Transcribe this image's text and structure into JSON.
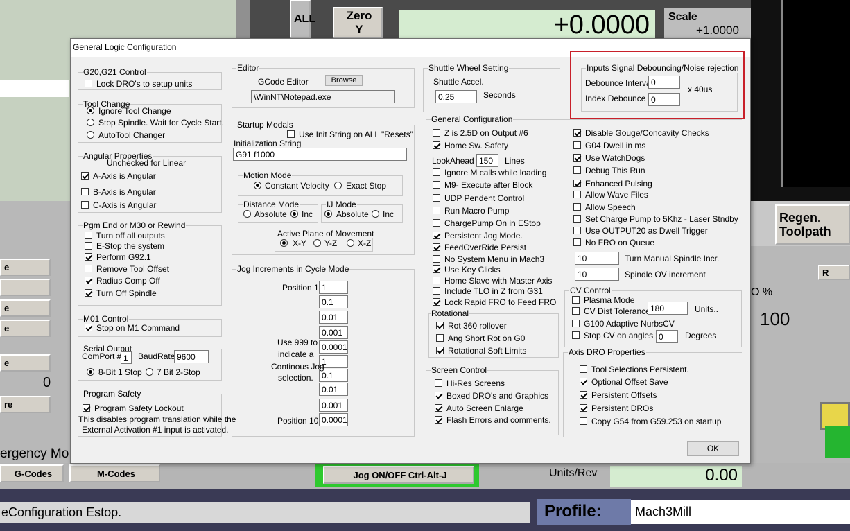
{
  "background": {
    "all_label": "ALL",
    "zero_label": "Zero",
    "zero_axis": "Y",
    "dro_value": "+0.0000",
    "scale_label": "Scale",
    "scale_value": "+1.0000",
    "regen_label": "Regen.\nToolpath",
    "pct_label": "O %",
    "pct_value": "100",
    "units_rev_label": "Units/Rev",
    "units_rev_value": "0.00",
    "left_zero": "0",
    "emergency_text": "ergency Mo",
    "gcodes_btn": "G-Codes",
    "mcodes_btn": "M-Codes",
    "jog_btn": "Jog ON/OFF Ctrl-Alt-J",
    "status_text": "eConfiguration Estop.",
    "profile_label": "Profile:",
    "profile_value": "Mach3Mill",
    "left_btns": [
      "e",
      "",
      "e",
      "e",
      "e",
      "re"
    ],
    "right_btn": "R"
  },
  "dialog": {
    "title": "General Logic Configuration",
    "g20": {
      "label": "G20,G21 Control",
      "lock_dro": "Lock DRO's to setup units",
      "lock_dro_checked": false
    },
    "tool_change": {
      "label": "Tool Change",
      "options": [
        "Ignore Tool Change",
        "Stop Spindle. Wait for Cycle Start.",
        "AutoTool Changer"
      ],
      "selected": 0
    },
    "angular": {
      "label": "Angular Properties",
      "note": "Unchecked for Linear",
      "a": "A-Axis is Angular",
      "a_checked": true,
      "b": "B-Axis is Angular",
      "b_checked": false,
      "c": "C-Axis is Angular",
      "c_checked": false
    },
    "pgm_end": {
      "label": "Pgm End or M30 or Rewind",
      "items": [
        {
          "text": "Turn off all outputs",
          "checked": false
        },
        {
          "text": "E-Stop the system",
          "checked": false
        },
        {
          "text": "Perform G92.1",
          "checked": true
        },
        {
          "text": "Remove Tool Offset",
          "checked": false
        },
        {
          "text": "Radius Comp Off",
          "checked": true
        },
        {
          "text": "Turn Off Spindle",
          "checked": true
        }
      ]
    },
    "m01": {
      "label": "M01 Control",
      "stop": "Stop on M1 Command",
      "stop_checked": true
    },
    "serial": {
      "label": "Serial Output",
      "comport_label": "ComPort #",
      "comport": "1",
      "baud_label": "BaudRate",
      "baud": "9600",
      "bit8": "8-Bit 1 Stop",
      "bit7": "7 Bit 2-Stop",
      "selected": 0
    },
    "safety": {
      "label": "Program Safety",
      "lockout": "Program Safety Lockout",
      "lockout_checked": true,
      "note1": "This disables program translation while the",
      "note2": "External Activation #1 input is activated."
    },
    "editor": {
      "label": "Editor",
      "gcode_label": "GCode Editor",
      "browse": "Browse",
      "path": "\\WinNT\\Notepad.exe"
    },
    "startup": {
      "label": "Startup Modals",
      "use_init": "Use Init String on ALL  \"Resets\"",
      "use_init_checked": false,
      "init_label": "Initialization String",
      "init_value": "G91 f1000",
      "motion_label": "Motion Mode",
      "constant": "Constant Velocity",
      "exact": "Exact Stop",
      "motion_sel": 0,
      "distance_label": "Distance Mode",
      "absolute": "Absolute",
      "inc": "Inc",
      "distance_sel": 1,
      "ij_label": "IJ Mode",
      "ij_absolute": "Absolute",
      "ij_inc": "Inc",
      "ij_sel": 0,
      "plane_label": "Active Plane of Movement",
      "xy": "X-Y",
      "yz": "Y-Z",
      "xz": "X-Z",
      "plane_sel": 0
    },
    "jog": {
      "label": "Jog Increments in Cycle Mode",
      "pos1": "Position 1",
      "pos10": "Position 10",
      "values": [
        "1",
        "0.1",
        "0.01",
        "0.001",
        "0.0001",
        "1",
        "0.1",
        "0.01",
        "0.001",
        "0.0001"
      ],
      "note": [
        "Use 999 to",
        "indicate a",
        "Continous Jog",
        "selection."
      ]
    },
    "shuttle": {
      "label": "Shuttle Wheel Setting",
      "accel_label": "Shuttle Accel.",
      "accel": "0.25",
      "seconds": "Seconds"
    },
    "debounce": {
      "label": "Inputs Signal Debouncing/Noise rejection",
      "interval_label": "Debounce Interval",
      "interval": "0",
      "index_label": "Index Debounce",
      "index": "0",
      "unit": "x 40us"
    },
    "general": {
      "label": "General Configuration",
      "left": [
        {
          "text": "Z is 2.5D on Output #6",
          "checked": false
        },
        {
          "text": "Home Sw. Safety",
          "checked": true
        }
      ],
      "lookahead_label": "LookAhead",
      "lookahead": "150",
      "lines": "Lines",
      "left2": [
        {
          "text": "Ignore M calls while loading",
          "checked": false
        },
        {
          "text": "M9- Execute after Block",
          "checked": false
        },
        {
          "text": "UDP Pendent Control",
          "checked": false
        },
        {
          "text": "Run Macro Pump",
          "checked": false
        },
        {
          "text": "ChargePump On in EStop",
          "checked": false
        },
        {
          "text": "Persistent Jog Mode.",
          "checked": true
        },
        {
          "text": "FeedOverRide Persist",
          "checked": true
        },
        {
          "text": "No System Menu in Mach3",
          "checked": false
        },
        {
          "text": "Use Key Clicks",
          "checked": true
        },
        {
          "text": "Home Slave with Master Axis",
          "checked": false
        },
        {
          "text": "Include TLO in Z from G31",
          "checked": false
        },
        {
          "text": "Lock Rapid FRO to Feed FRO",
          "checked": true
        }
      ],
      "right": [
        {
          "text": "Disable Gouge/Concavity Checks",
          "checked": true
        },
        {
          "text": "G04 Dwell in ms",
          "checked": false
        },
        {
          "text": "Use WatchDogs",
          "checked": true
        },
        {
          "text": "Debug This Run",
          "checked": false
        },
        {
          "text": "Enhanced Pulsing",
          "checked": true
        },
        {
          "text": "Allow Wave Files",
          "checked": false
        },
        {
          "text": "Allow Speech",
          "checked": false
        },
        {
          "text": "Set Charge Pump to 5Khz  - Laser Stndby",
          "checked": false
        },
        {
          "text": "Use OUTPUT20 as Dwell Trigger",
          "checked": false
        },
        {
          "text": "No FRO on Queue",
          "checked": false
        }
      ],
      "manual_spindle": "10",
      "manual_spindle_label": "Turn Manual Spindle Incr.",
      "spindle_ov": "10",
      "spindle_ov_label": "Spindle OV increment"
    },
    "rotational": {
      "label": "Rotational",
      "items": [
        {
          "text": "Rot 360 rollover",
          "checked": true
        },
        {
          "text": "Ang Short Rot on G0",
          "checked": false
        },
        {
          "text": "Rotational Soft Limits",
          "checked": true
        }
      ]
    },
    "screen": {
      "label": "Screen Control",
      "items": [
        {
          "text": "Hi-Res Screens",
          "checked": false
        },
        {
          "text": "Boxed DRO's and Graphics",
          "checked": true
        },
        {
          "text": "Auto Screen Enlarge",
          "checked": true
        },
        {
          "text": "Flash Errors and comments.",
          "checked": true
        }
      ]
    },
    "cv": {
      "label": "CV Control",
      "plasma": "Plasma Mode",
      "plasma_checked": false,
      "dist": "CV Dist Tolerance",
      "dist_checked": false,
      "dist_value": "180",
      "units": "Units..",
      "g100": "G100 Adaptive NurbsCV",
      "g100_checked": false,
      "stop": "Stop CV on angles >",
      "stop_checked": false,
      "stop_value": "0",
      "degrees": "Degrees"
    },
    "axis_dro": {
      "label": "Axis DRO Properties",
      "items": [
        {
          "text": "Tool Selections Persistent.",
          "checked": false
        },
        {
          "text": "Optional Offset Save",
          "checked": true
        },
        {
          "text": "Persistent Offsets",
          "checked": true
        },
        {
          "text": "Persistent DROs",
          "checked": true
        },
        {
          "text": "Copy G54 from G59.253 on startup",
          "checked": false
        }
      ]
    },
    "ok": "OK"
  }
}
